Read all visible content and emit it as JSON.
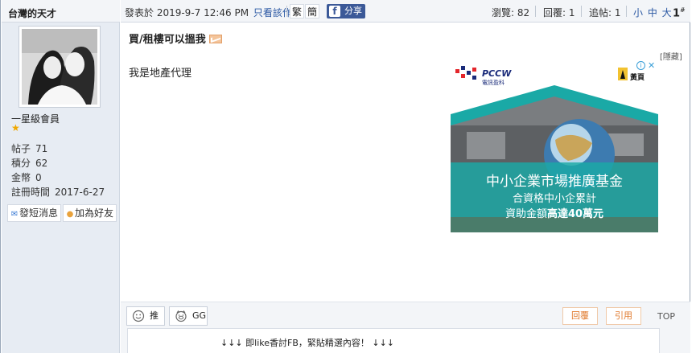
{
  "user": {
    "name": "台灣的天才",
    "rank": "一星級會員",
    "stats": [
      {
        "label": "帖子",
        "value": "71"
      },
      {
        "label": "積分",
        "value": "62"
      },
      {
        "label": "金幣",
        "value": "0"
      },
      {
        "label": "註冊時間",
        "value": "2017-6-27"
      }
    ],
    "buttons": {
      "message": "發短消息",
      "friend": "加為好友"
    }
  },
  "header": {
    "posted": "發表於 2019-9-7 12:46 PM",
    "author_only": "只看該作者",
    "trad": "繁",
    "simp": "簡",
    "share": "分享",
    "views": "瀏覽: 82",
    "replies": "回覆: 1",
    "follows": "追帖: 1",
    "sizes": "小 中 大",
    "floor": "1",
    "floor_sup": "#"
  },
  "post": {
    "title": "買/租樓可以搵我",
    "hide": "[隱藏]",
    "text": "我是地產代理"
  },
  "ad": {
    "brand": "PCCW",
    "brand_sub": "電訊盈科",
    "yp": "黃頁",
    "line1": "中小企業市場推廣基金",
    "line2": "合資格中小企累計",
    "line3_a": "資助金額",
    "line3_b": "高達40萬元",
    "info": "i",
    "close": "✕"
  },
  "toolbar": {
    "push": "推",
    "gg": "GG",
    "reply": "回覆",
    "quote": "引用",
    "top": "TOP",
    "fb_line": "↓↓↓ 即like香討FB，緊貼精選內容！ ↓↓↓"
  }
}
